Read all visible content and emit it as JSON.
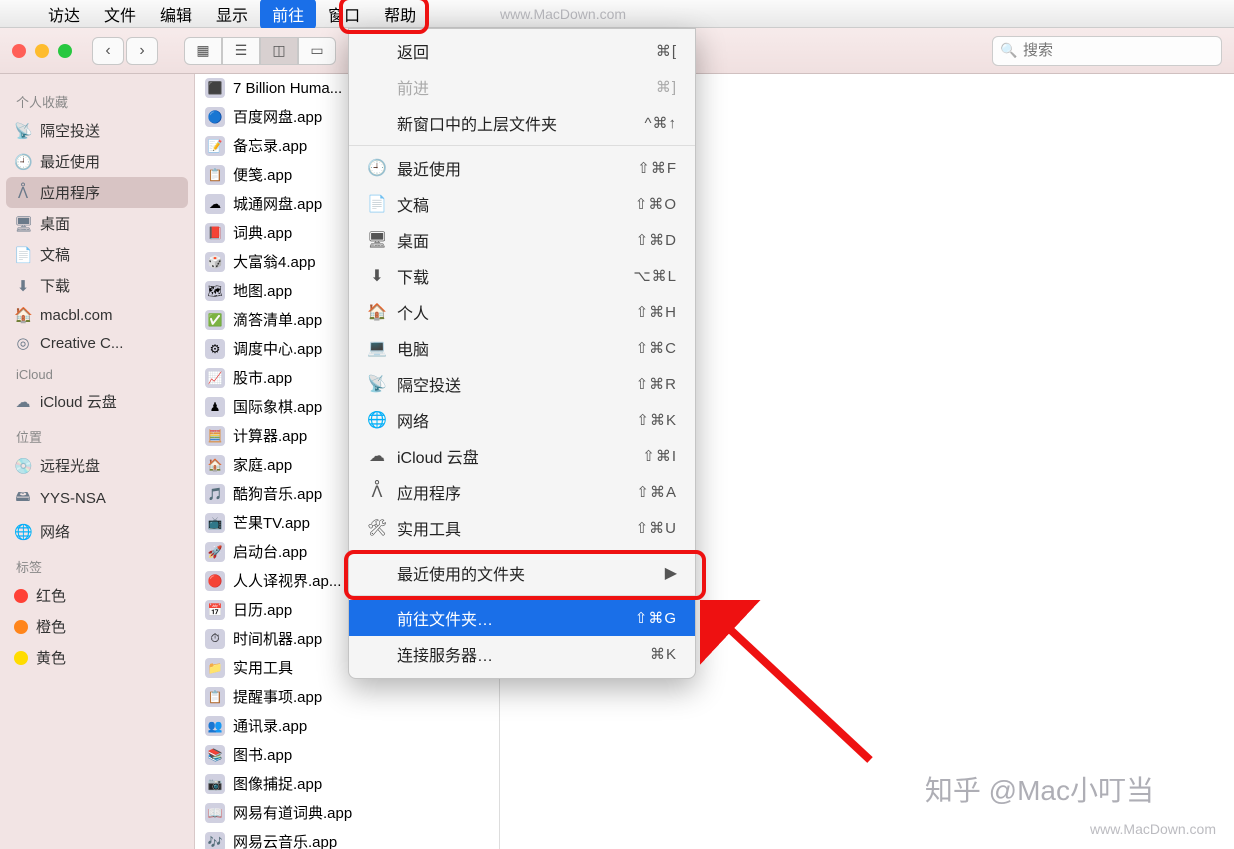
{
  "menubar": {
    "items": [
      "访达",
      "文件",
      "编辑",
      "显示",
      "前往",
      "窗口",
      "帮助"
    ],
    "active_index": 4
  },
  "toolbar": {
    "search_placeholder": "搜索"
  },
  "sidebar": {
    "sections": [
      {
        "header": "个人收藏",
        "items": [
          {
            "icon": "📡",
            "label": "隔空投送"
          },
          {
            "icon": "🕘",
            "label": "最近使用"
          },
          {
            "icon": "ᐰ",
            "label": "应用程序",
            "selected": true
          },
          {
            "icon": "🖥",
            "label": "桌面"
          },
          {
            "icon": "📄",
            "label": "文稿"
          },
          {
            "icon": "⬇",
            "label": "下载"
          },
          {
            "icon": "🏠",
            "label": "macbl.com"
          },
          {
            "icon": "◎",
            "label": "Creative C..."
          }
        ]
      },
      {
        "header": "iCloud",
        "items": [
          {
            "icon": "☁",
            "label": "iCloud 云盘"
          }
        ]
      },
      {
        "header": "位置",
        "items": [
          {
            "icon": "💿",
            "label": "远程光盘"
          },
          {
            "icon": "🖴",
            "label": "YYS-NSA"
          },
          {
            "icon": "🌐",
            "label": "网络"
          }
        ]
      },
      {
        "header": "标签",
        "items": [
          {
            "dot": "#ff4136",
            "label": "红色"
          },
          {
            "dot": "#ff851b",
            "label": "橙色"
          },
          {
            "dot": "#ffdc00",
            "label": "黄色"
          }
        ]
      }
    ]
  },
  "column": {
    "items": [
      {
        "icon": "⬛",
        "label": "7 Billion Huma..."
      },
      {
        "icon": "🔵",
        "label": "百度网盘.app"
      },
      {
        "icon": "📝",
        "label": "备忘录.app"
      },
      {
        "icon": "📋",
        "label": "便笺.app"
      },
      {
        "icon": "☁",
        "label": "城通网盘.app"
      },
      {
        "icon": "📕",
        "label": "词典.app"
      },
      {
        "icon": "🎲",
        "label": "大富翁4.app"
      },
      {
        "icon": "🗺",
        "label": "地图.app"
      },
      {
        "icon": "✅",
        "label": "滴答清单.app"
      },
      {
        "icon": "⚙",
        "label": "调度中心.app"
      },
      {
        "icon": "📈",
        "label": "股市.app"
      },
      {
        "icon": "♟",
        "label": "国际象棋.app"
      },
      {
        "icon": "🧮",
        "label": "计算器.app"
      },
      {
        "icon": "🏠",
        "label": "家庭.app"
      },
      {
        "icon": "🎵",
        "label": "酷狗音乐.app"
      },
      {
        "icon": "📺",
        "label": "芒果TV.app"
      },
      {
        "icon": "🚀",
        "label": "启动台.app"
      },
      {
        "icon": "🔴",
        "label": "人人译视界.ap..."
      },
      {
        "icon": "📅",
        "label": "日历.app"
      },
      {
        "icon": "⏱",
        "label": "时间机器.app"
      },
      {
        "icon": "📁",
        "label": "实用工具",
        "folder": true
      },
      {
        "icon": "📋",
        "label": "提醒事项.app"
      },
      {
        "icon": "👥",
        "label": "通讯录.app"
      },
      {
        "icon": "📚",
        "label": "图书.app"
      },
      {
        "icon": "📷",
        "label": "图像捕捉.app"
      },
      {
        "icon": "📖",
        "label": "网易有道词典.app"
      },
      {
        "icon": "🎶",
        "label": "网易云音乐.app"
      }
    ]
  },
  "menu": {
    "groups": [
      [
        {
          "label": "返回",
          "shortcut": "⌘["
        },
        {
          "label": "前进",
          "shortcut": "⌘]",
          "disabled": true
        },
        {
          "label": "新窗口中的上层文件夹",
          "shortcut": "^⌘↑"
        }
      ],
      [
        {
          "icon": "🕘",
          "label": "最近使用",
          "shortcut": "⇧⌘F"
        },
        {
          "icon": "📄",
          "label": "文稿",
          "shortcut": "⇧⌘O"
        },
        {
          "icon": "🖥",
          "label": "桌面",
          "shortcut": "⇧⌘D"
        },
        {
          "icon": "⬇",
          "label": "下载",
          "shortcut": "⌥⌘L"
        },
        {
          "icon": "🏠",
          "label": "个人",
          "shortcut": "⇧⌘H"
        },
        {
          "icon": "💻",
          "label": "电脑",
          "shortcut": "⇧⌘C"
        },
        {
          "icon": "📡",
          "label": "隔空投送",
          "shortcut": "⇧⌘R"
        },
        {
          "icon": "🌐",
          "label": "网络",
          "shortcut": "⇧⌘K"
        },
        {
          "icon": "☁",
          "label": "iCloud 云盘",
          "shortcut": "⇧⌘I"
        },
        {
          "icon": "ᐰ",
          "label": "应用程序",
          "shortcut": "⇧⌘A"
        },
        {
          "icon": "🛠",
          "label": "实用工具",
          "shortcut": "⇧⌘U"
        }
      ],
      [
        {
          "label": "最近使用的文件夹",
          "submenu": true
        }
      ],
      [
        {
          "label": "前往文件夹…",
          "shortcut": "⇧⌘G",
          "selected": true
        },
        {
          "label": "连接服务器…",
          "shortcut": "⌘K"
        }
      ]
    ]
  },
  "watermarks": {
    "top": "www.MacDown.com",
    "zhihu": "知乎 @Mac小叮当",
    "bottom": "www.MacDown.com"
  }
}
